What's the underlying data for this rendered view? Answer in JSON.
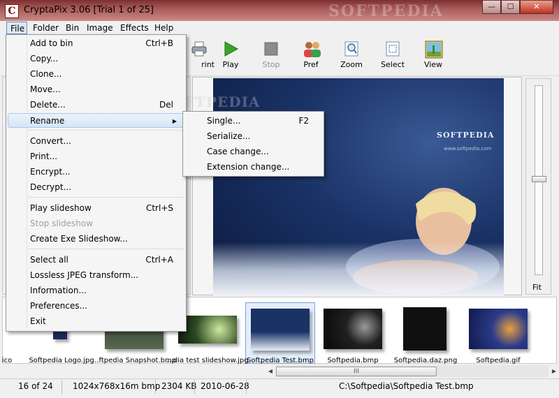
{
  "window": {
    "title": "CryptaPix 3.06  [Trial 1 of 25]",
    "icon_letter": "C",
    "watermark": "SOFTPEDIA",
    "controls": {
      "minimize": "—",
      "maximize": "☐",
      "close": "✕"
    }
  },
  "menubar": [
    "File",
    "Folder",
    "Bin",
    "Image",
    "Effects",
    "Help"
  ],
  "toolbar": [
    {
      "label": "Print",
      "icon": "printer-icon",
      "visible_label": "rint"
    },
    {
      "label": "Play",
      "icon": "play-icon"
    },
    {
      "label": "Stop",
      "icon": "stop-icon",
      "disabled": true
    },
    {
      "label": "Pref",
      "icon": "users-icon"
    },
    {
      "label": "Zoom",
      "icon": "zoom-icon"
    },
    {
      "label": "Select",
      "icon": "select-icon"
    },
    {
      "label": "View",
      "icon": "view-icon"
    }
  ],
  "file_menu": [
    {
      "label": "Add to bin",
      "shortcut": "Ctrl+B"
    },
    {
      "label": "Copy..."
    },
    {
      "label": "Clone..."
    },
    {
      "label": "Move..."
    },
    {
      "label": "Delete...",
      "shortcut": "Del"
    },
    {
      "label": "Rename",
      "submenu": true,
      "highlighted": true
    },
    {
      "label": "Convert..."
    },
    {
      "label": "Print..."
    },
    {
      "label": "Encrypt..."
    },
    {
      "label": "Decrypt..."
    },
    {
      "label": "Play slideshow",
      "shortcut": "Ctrl+S"
    },
    {
      "label": "Stop slideshow",
      "disabled": true
    },
    {
      "label": "Create Exe Slideshow..."
    },
    {
      "label": "Select all",
      "shortcut": "Ctrl+A"
    },
    {
      "label": "Lossless JPEG transform..."
    },
    {
      "label": "Information..."
    },
    {
      "label": "Preferences..."
    },
    {
      "label": "Exit"
    }
  ],
  "rename_submenu": [
    {
      "label": "Single...",
      "shortcut": "F2"
    },
    {
      "label": "Serialize..."
    },
    {
      "label": "Case change..."
    },
    {
      "label": "Extension change..."
    }
  ],
  "preview": {
    "brand": "SOFTPEDIA",
    "url": "www.softpedia.com",
    "watermark": "SOFTPEDIA"
  },
  "zoom": {
    "fit_label": "Fit"
  },
  "thumbnails": [
    {
      "caption": "ico"
    },
    {
      "caption": "Softpedia Logo.jpg"
    },
    {
      "caption": "...ftpedia Snapshot.bmp"
    },
    {
      "caption": "...dia test slideshow.jpg"
    },
    {
      "caption": "Softpedia Test.bmp",
      "selected": true
    },
    {
      "caption": "Softpedia.bmp"
    },
    {
      "caption": "Softpedia.daz.png"
    },
    {
      "caption": "Softpedia.gif"
    }
  ],
  "scrollbar": {
    "grip": "III"
  },
  "statusbar": {
    "position": "16 of 24",
    "dimensions": "1024x768x16m bmp",
    "size": "2304 KB",
    "date": "2010-06-28",
    "path": "C:\\Softpedia\\Softpedia Test.bmp"
  },
  "colors": {
    "title_bar": "#a85a58",
    "menu_highlight": "#d6e6f8",
    "selection_border": "#7aa2d8",
    "preview_background": "#1a3266"
  }
}
